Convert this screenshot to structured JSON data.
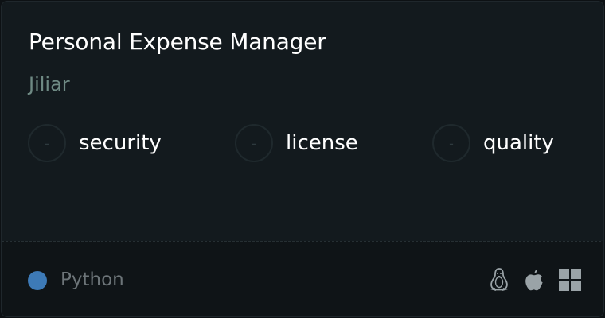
{
  "card": {
    "title": "Personal Expense Manager",
    "owner": "Jiliar"
  },
  "scores": [
    {
      "label": "security",
      "value": "-"
    },
    {
      "label": "license",
      "value": "-"
    },
    {
      "label": "quality",
      "value": "-"
    }
  ],
  "footer": {
    "language": "Python",
    "language_color": "#3d7ab7",
    "platforms": [
      "linux-icon",
      "apple-icon",
      "windows-icon"
    ]
  }
}
